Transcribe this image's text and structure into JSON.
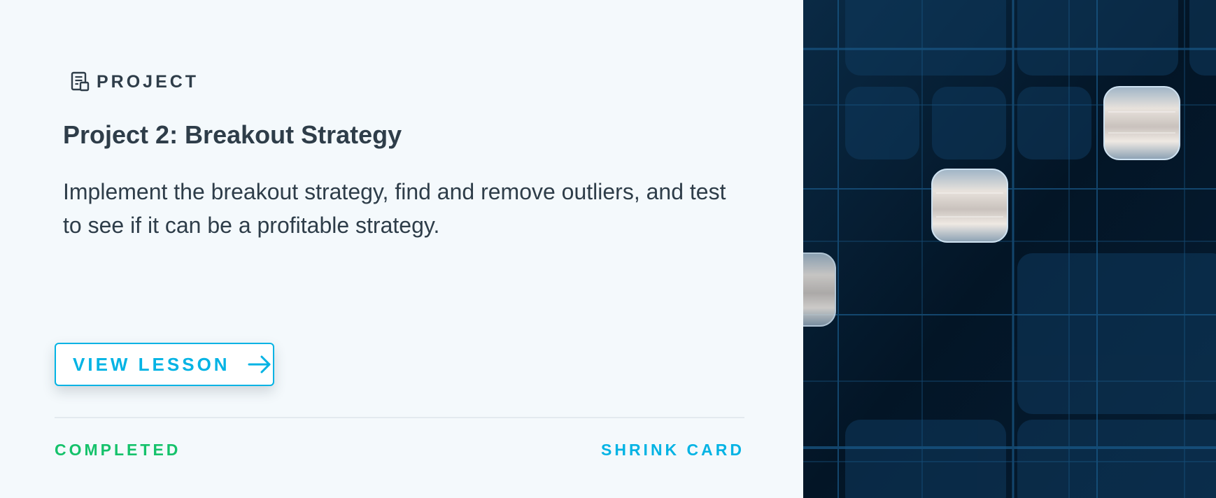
{
  "card": {
    "type_label": "PROJECT",
    "type_icon": "project-document-icon",
    "title": "Project 2: Breakout Strategy",
    "description": "Implement the breakout strategy, find and remove outliers, and test to see if it can be a profitable strategy.",
    "view_button_label": "VIEW LESSON",
    "view_button_icon": "arrow-right-icon",
    "status": "COMPLETED",
    "shrink_label": "SHRINK CARD"
  },
  "colors": {
    "accent": "#02b3e4",
    "status_completed": "#15c26b",
    "text": "#2e3d49",
    "background": "#f4f9fc"
  }
}
